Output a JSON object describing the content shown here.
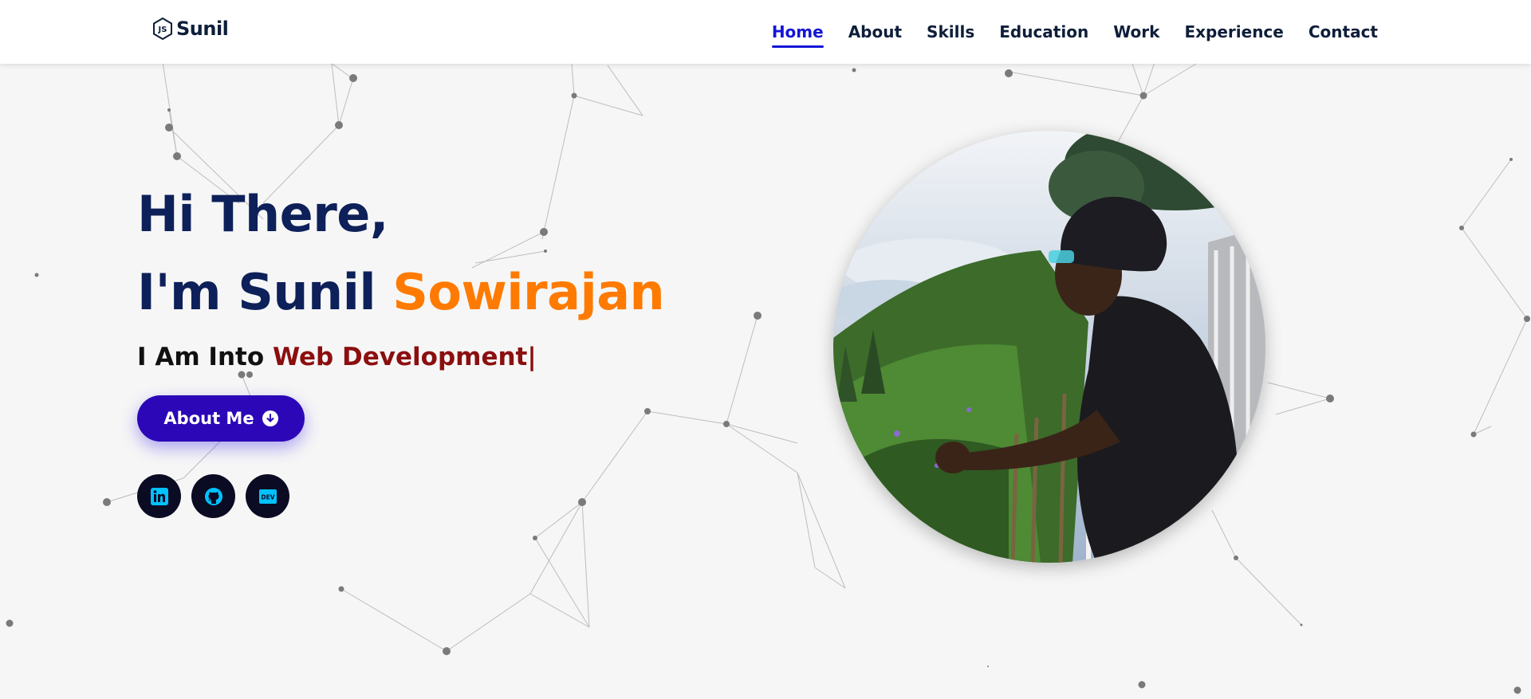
{
  "brand": {
    "name": "Sunil",
    "logo_icon": "js-hexagon-icon"
  },
  "nav": {
    "items": [
      {
        "label": "Home",
        "active": true
      },
      {
        "label": "About"
      },
      {
        "label": "Skills"
      },
      {
        "label": "Education"
      },
      {
        "label": "Work"
      },
      {
        "label": "Experience"
      },
      {
        "label": "Contact"
      }
    ],
    "active_color": "#1515d8"
  },
  "hero": {
    "greeting": "Hi There,",
    "intro_prefix": "I'm Sunil ",
    "intro_highlight": "Sowirajan",
    "tagline_prefix": "I Am Into ",
    "tagline_typed": "Web Development",
    "cursor": "|",
    "button_label": "About Me",
    "button_icon": "arrow-circle-down-icon"
  },
  "socials": [
    {
      "name": "linkedin",
      "icon": "linkedin-icon"
    },
    {
      "name": "github",
      "icon": "github-icon"
    },
    {
      "name": "dev",
      "icon": "dev-icon",
      "label": "DEV"
    }
  ],
  "colors": {
    "navy": "#0d2059",
    "orange": "#ff7a00",
    "typed_red": "#8b0f0f",
    "button": "#2b07b8",
    "social_bg": "#0b0b24",
    "social_icon": "#00c2ff"
  },
  "photo": {
    "alt_icon": "profile-photo"
  }
}
